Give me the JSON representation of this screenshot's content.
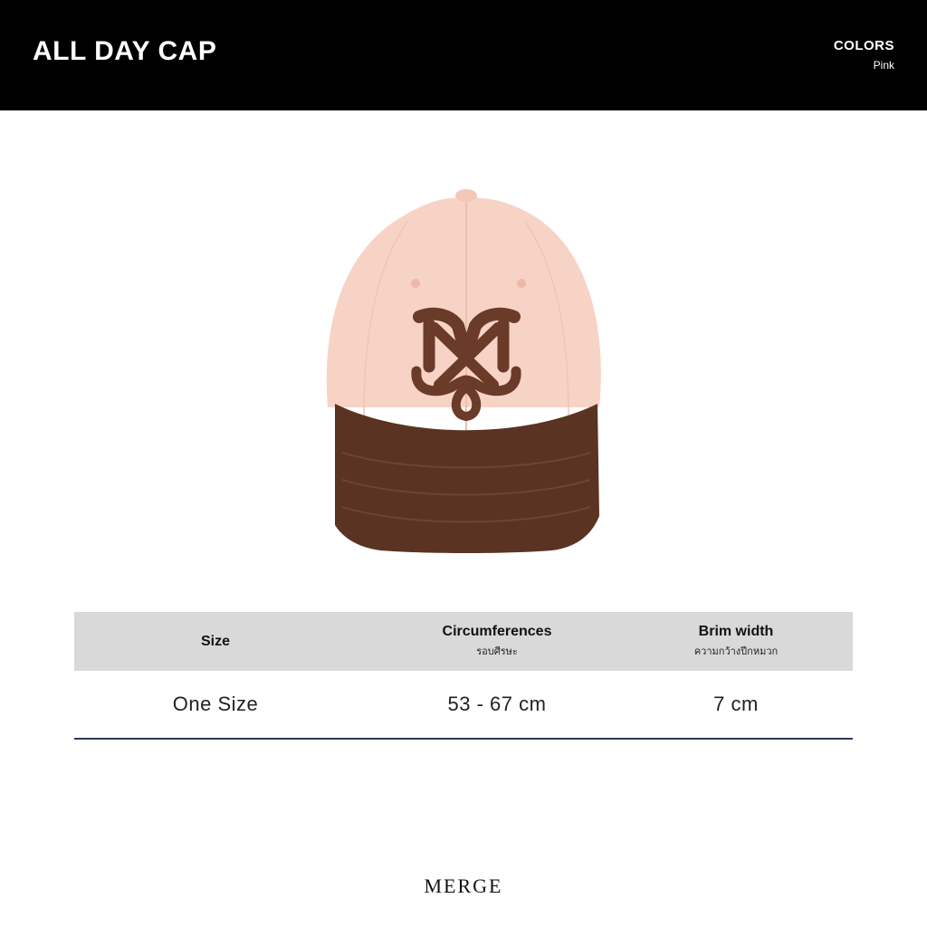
{
  "header": {
    "title": "ALL DAY CAP",
    "colors_label": "COLORS",
    "colors_value": "Pink"
  },
  "product": {
    "crown_color": "#f7d3c6",
    "brim_color": "#5a3322",
    "logo_color": "#6a3b28"
  },
  "size_table": {
    "headers": [
      {
        "main": "Size",
        "sub": ""
      },
      {
        "main": "Circumferences",
        "sub": "รอบศีรษะ"
      },
      {
        "main": "Brim width",
        "sub": "ความกว้างปีกหมวก"
      }
    ],
    "rows": [
      [
        "One Size",
        "53 - 67 cm",
        "7 cm"
      ]
    ]
  },
  "footer": {
    "brand": "MERGE"
  }
}
